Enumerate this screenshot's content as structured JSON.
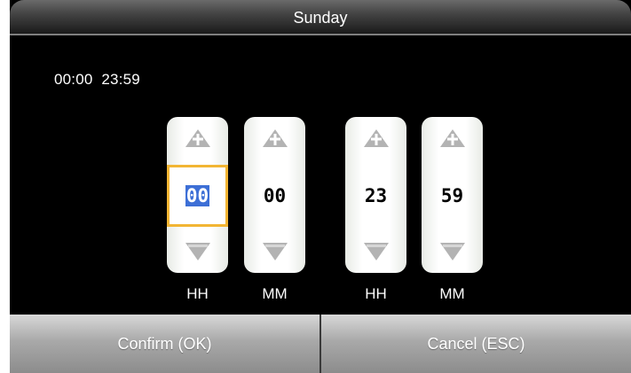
{
  "header": {
    "title": "Sunday"
  },
  "range_text": "00:00  23:59",
  "spinners": [
    {
      "value": "00",
      "unit": "HH",
      "focused": true
    },
    {
      "value": "00",
      "unit": "MM",
      "focused": false
    },
    {
      "value": "23",
      "unit": "HH",
      "focused": false
    },
    {
      "value": "59",
      "unit": "MM",
      "focused": false
    }
  ],
  "footer": {
    "confirm_label": "Confirm (OK)",
    "cancel_label": "Cancel (ESC)"
  },
  "colors": {
    "focus_border": "#f2b533",
    "selection": "#3d6fd6",
    "background": "#000000"
  },
  "icons": {
    "increment": "plus-arrow-icon",
    "decrement": "down-triangle-icon"
  }
}
